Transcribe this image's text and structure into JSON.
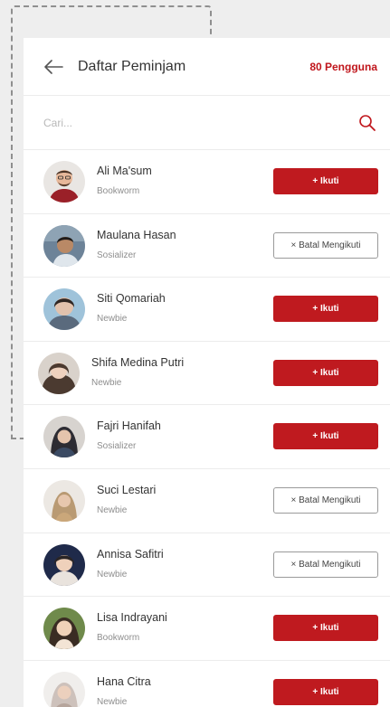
{
  "header": {
    "title": "Daftar Peminjam",
    "count": "80 Pengguna"
  },
  "search": {
    "placeholder": "Cari..."
  },
  "colors": {
    "accent": "#bf1a1f",
    "text": "#333333",
    "muted": "#8e8e8e"
  },
  "icons": {
    "back": "arrow-left-icon",
    "search": "search-icon"
  },
  "users": [
    {
      "name": "Ali Ma'sum",
      "role": "Bookworm",
      "action": "+ Ikuti",
      "following": false
    },
    {
      "name": "Maulana Hasan",
      "role": "Sosializer",
      "action": "× Batal Mengikuti",
      "following": true
    },
    {
      "name": "Siti Qomariah",
      "role": "Newbie",
      "action": "+ Ikuti",
      "following": false
    },
    {
      "name": "Shifa Medina Putri",
      "role": "Newbie",
      "action": "+ Ikuti",
      "following": false
    },
    {
      "name": "Fajri Hanifah",
      "role": "Sosializer",
      "action": "+ Ikuti",
      "following": false
    },
    {
      "name": "Suci Lestari",
      "role": "Newbie",
      "action": "× Batal Mengikuti",
      "following": true
    },
    {
      "name": "Annisa Safitri",
      "role": "Newbie",
      "action": "× Batal Mengikuti",
      "following": true
    },
    {
      "name": "Lisa Indrayani",
      "role": "Bookworm",
      "action": "+ Ikuti",
      "following": false
    },
    {
      "name": "Hana Citra",
      "role": "Newbie",
      "action": "+ Ikuti",
      "following": false
    }
  ]
}
